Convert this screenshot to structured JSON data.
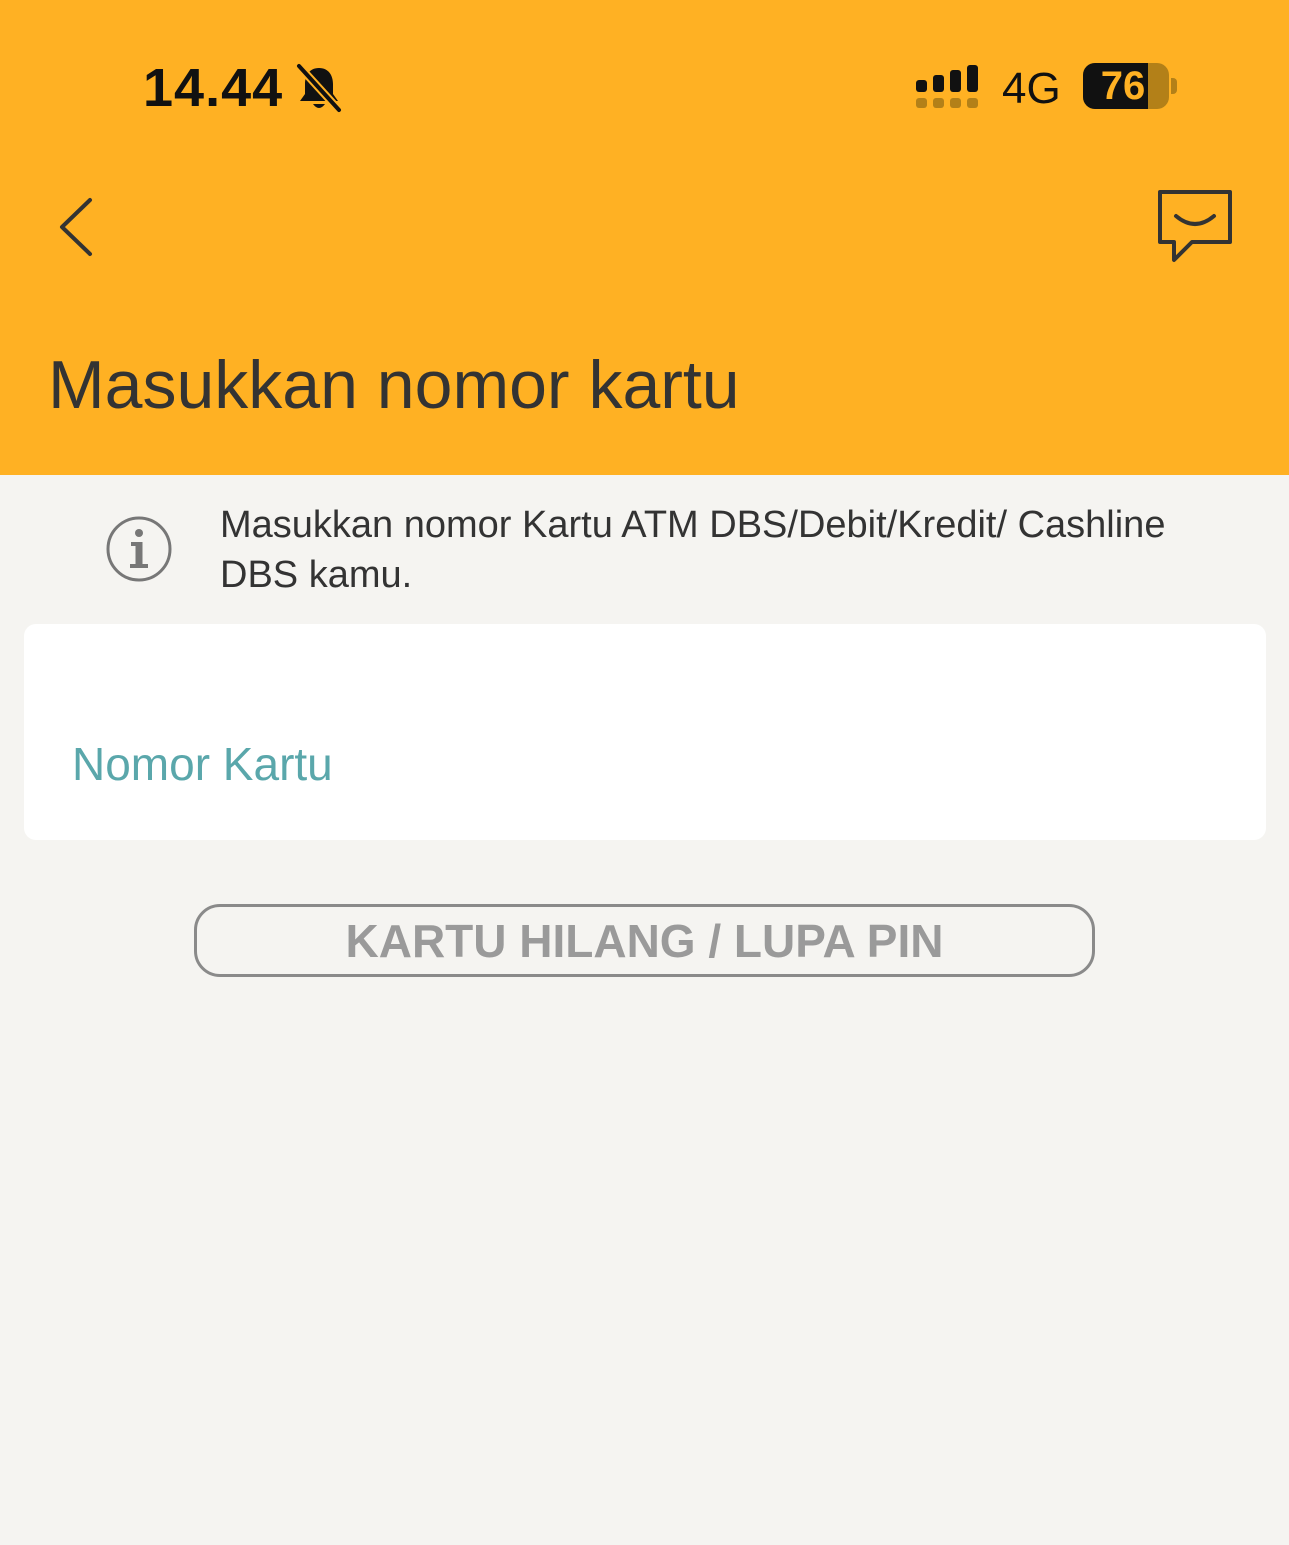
{
  "status_bar": {
    "time": "14.44",
    "network": "4G",
    "battery_percent": "76",
    "battery_level": 0.76,
    "icons": [
      "bell-off-icon",
      "signal-icon"
    ]
  },
  "header": {
    "back_icon": "chevron-left-icon",
    "chat_icon": "chat-bubble-icon",
    "title": "Masukkan nomor kartu",
    "background_color": "#ffb123"
  },
  "info": {
    "icon": "info-icon",
    "text": "Masukkan nomor Kartu ATM DBS/Debit/Kredit/ Cashline DBS kamu."
  },
  "card_input": {
    "placeholder": "Nomor Kartu",
    "value": ""
  },
  "buttons": {
    "lost_card_label": "KARTU HILANG / LUPA PIN"
  }
}
